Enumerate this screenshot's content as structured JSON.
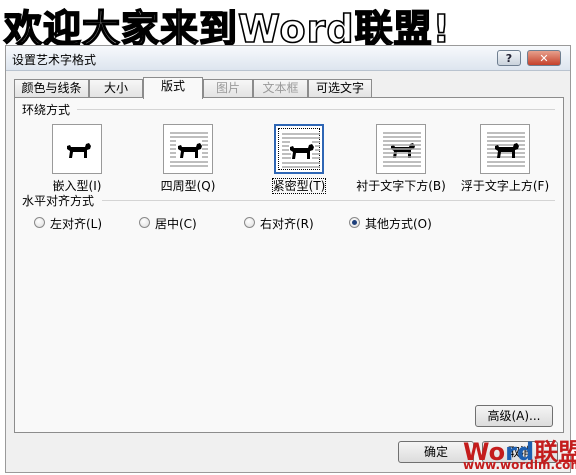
{
  "banner": {
    "text": "欢迎大家来到Word联盟!"
  },
  "dialog": {
    "title": "设置艺术字格式",
    "help_label": "?",
    "close_label": "✕"
  },
  "tabs": [
    {
      "label": "颜色与线条"
    },
    {
      "label": "大小"
    },
    {
      "label": "版式"
    },
    {
      "label": "图片"
    },
    {
      "label": "文本框"
    },
    {
      "label": "可选文字"
    }
  ],
  "wrap": {
    "section_label": "环绕方式",
    "options": [
      {
        "label": "嵌入型(I)"
      },
      {
        "label": "四周型(Q)"
      },
      {
        "label": "紧密型(T)"
      },
      {
        "label": "衬于文字下方(B)"
      },
      {
        "label": "浮于文字上方(F)"
      }
    ],
    "selected": "紧密型(T)"
  },
  "halign": {
    "section_label": "水平对齐方式",
    "options": [
      {
        "label": "左对齐(L)"
      },
      {
        "label": "居中(C)"
      },
      {
        "label": "右对齐(R)"
      },
      {
        "label": "其他方式(O)"
      }
    ],
    "selected": "其他方式(O)"
  },
  "buttons": {
    "advanced": "高级(A)...",
    "ok": "确定",
    "cancel": "取消"
  },
  "watermark": {
    "logo_part1": "Wo",
    "logo_part2": "rd",
    "logo_part3": "联盟",
    "url": "www.wordlm.com"
  }
}
